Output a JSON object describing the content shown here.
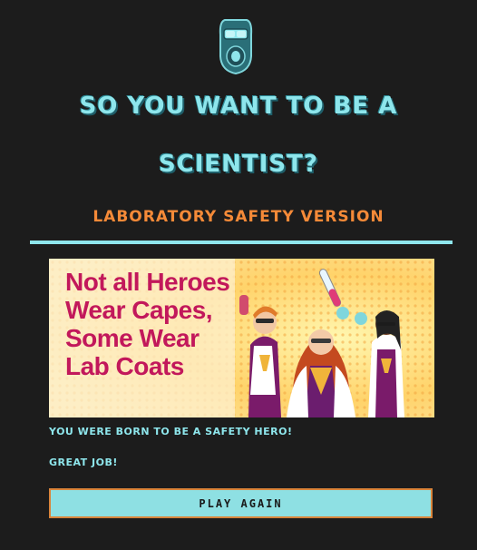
{
  "header": {
    "title_line1": "SO YOU WANT TO BE A",
    "title_line2": "SCIENTIST?",
    "subtitle": "LABORATORY SAFETY VERSION"
  },
  "banner": {
    "lines": [
      "Not all Heroes",
      "Wear Capes,",
      "Some Wear",
      "Lab Coats"
    ]
  },
  "result": {
    "message1": "YOU WERE BORN TO BE A SAFETY HERO!",
    "message2": "GREAT JOB!"
  },
  "actions": {
    "play_again_label": "PLAY AGAIN"
  },
  "colors": {
    "background": "#1c1c1c",
    "accent_cyan": "#8ee6ec",
    "accent_orange": "#f58a38",
    "banner_text": "#c2185b"
  },
  "icons": {
    "logo": "safety-goggles-mask-icon"
  }
}
